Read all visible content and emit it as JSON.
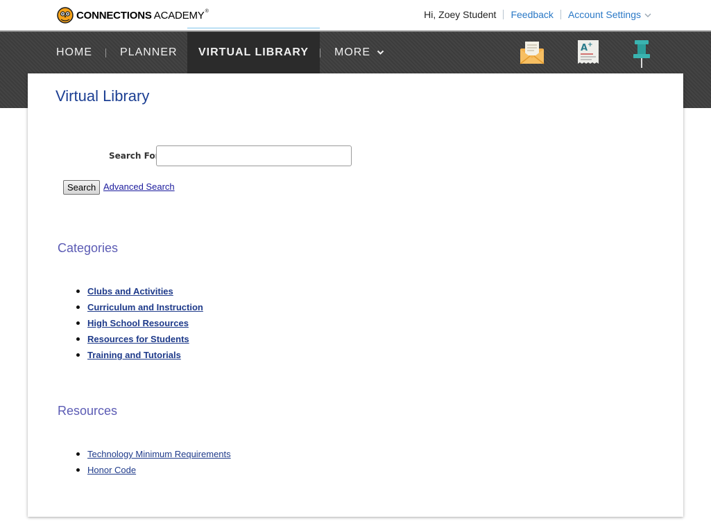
{
  "brand": {
    "name_bold": "CONNECTIONS",
    "name_light": "ACADEMY",
    "registered": "®"
  },
  "user_bar": {
    "greeting": "Hi, Zoey Student",
    "feedback": "Feedback",
    "account_settings": "Account Settings"
  },
  "nav": {
    "items": [
      {
        "label": "HOME"
      },
      {
        "label": "PLANNER"
      },
      {
        "label": "VIRTUAL LIBRARY",
        "active": true
      },
      {
        "label": "MORE"
      }
    ],
    "icons": [
      "mail-icon",
      "grades-icon",
      "pin-icon"
    ]
  },
  "page": {
    "title": "Virtual Library"
  },
  "search": {
    "label": "Search For:",
    "value": "",
    "button": "Search",
    "advanced_link": "Advanced Search"
  },
  "categories": {
    "heading": "Categories",
    "items": [
      "Clubs and Activities",
      "Curriculum and Instruction",
      "High School Resources",
      "Resources for Students",
      "Training and Tutorials"
    ]
  },
  "resources": {
    "heading": "Resources",
    "items": [
      "Technology Minimum Requirements",
      "Honor Code"
    ]
  },
  "colors": {
    "nav_bg": "#3f3f3f",
    "active_tab": "#2b2b2b",
    "title": "#1c3f93",
    "section_heading": "#5b5bb4",
    "link": "#2a78c6"
  }
}
